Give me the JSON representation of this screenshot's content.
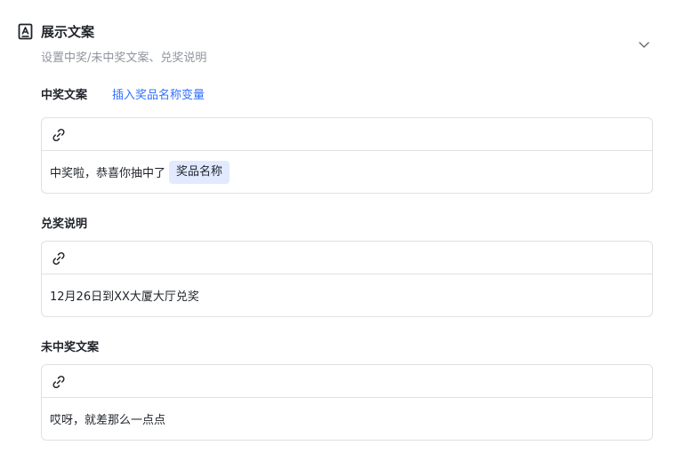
{
  "header": {
    "title": "展示文案",
    "subtitle": "设置中奖/未中奖文案、兑奖说明",
    "icon": "text-box-icon",
    "collapse_icon": "chevron-down-icon"
  },
  "win": {
    "label": "中奖文案",
    "insert_link": "插入奖品名称变量",
    "text": "中奖啦，恭喜你抽中了",
    "variable": "奖品名称"
  },
  "redeem": {
    "label": "兑奖说明",
    "text": "12月26日到XX大厦大厅兑奖"
  },
  "lose": {
    "label": "未中奖文案",
    "text": "哎呀，就差那么一点点"
  },
  "colors": {
    "accent": "#3370ff",
    "tag_bg": "#e1eaff",
    "border": "#dee0e3"
  }
}
